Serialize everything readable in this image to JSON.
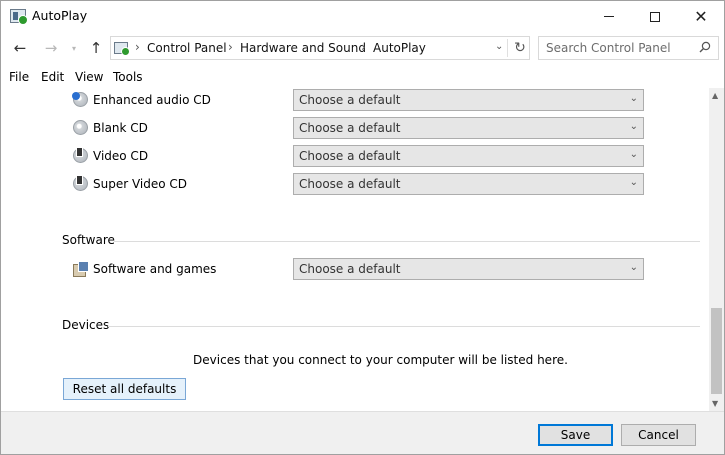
{
  "window": {
    "title": "AutoPlay"
  },
  "window_controls": {
    "minimize": "minimize",
    "maximize": "maximize",
    "close": "close"
  },
  "address": {
    "crumbs": [
      "Control Panel",
      "Hardware and Sound",
      "AutoPlay"
    ],
    "search_placeholder": "Search Control Panel"
  },
  "menu": [
    "File",
    "Edit",
    "View",
    "Tools"
  ],
  "media_rows": [
    {
      "label": "Enhanced audio CD",
      "icon": "enhanced-audio-cd-icon",
      "value": "Choose a default"
    },
    {
      "label": "Blank CD",
      "icon": "blank-cd-icon",
      "value": "Choose a default"
    },
    {
      "label": "Video CD",
      "icon": "video-cd-icon",
      "value": "Choose a default"
    },
    {
      "label": "Super Video CD",
      "icon": "super-video-cd-icon",
      "value": "Choose a default"
    }
  ],
  "software": {
    "section_title": "Software",
    "label": "Software and games",
    "icon": "software-games-icon",
    "value": "Choose a default"
  },
  "devices": {
    "section_title": "Devices",
    "note": "Devices that you connect to your computer will be listed here."
  },
  "buttons": {
    "reset": "Reset all defaults",
    "save": "Save",
    "cancel": "Cancel"
  },
  "colors": {
    "accent": "#0078d7",
    "select_bg": "#e6e6e6",
    "footer_bg": "#f0f0f0"
  }
}
